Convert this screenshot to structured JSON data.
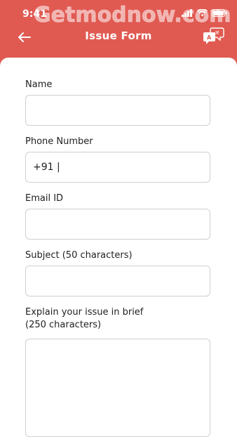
{
  "status": {
    "time": "9:41"
  },
  "watermark": "Getmodnow.com",
  "header": {
    "title": "Issue Form",
    "back_icon": "arrow-left-icon",
    "lang_icon": "translate-icon"
  },
  "form": {
    "name_label": "Name",
    "name_value": "",
    "phone_label": "Phone Number",
    "phone_value": "+91 |",
    "email_label": "Email ID",
    "email_value": "",
    "subject_label": "Subject (50 characters)",
    "subject_value": "",
    "issue_label_line1": "Explain your issue in brief",
    "issue_label_line2": "(250 characters)",
    "issue_value": ""
  },
  "colors": {
    "header_bg": "#e05a52",
    "card_bg": "#ffffff",
    "border": "#cfcfcf"
  }
}
